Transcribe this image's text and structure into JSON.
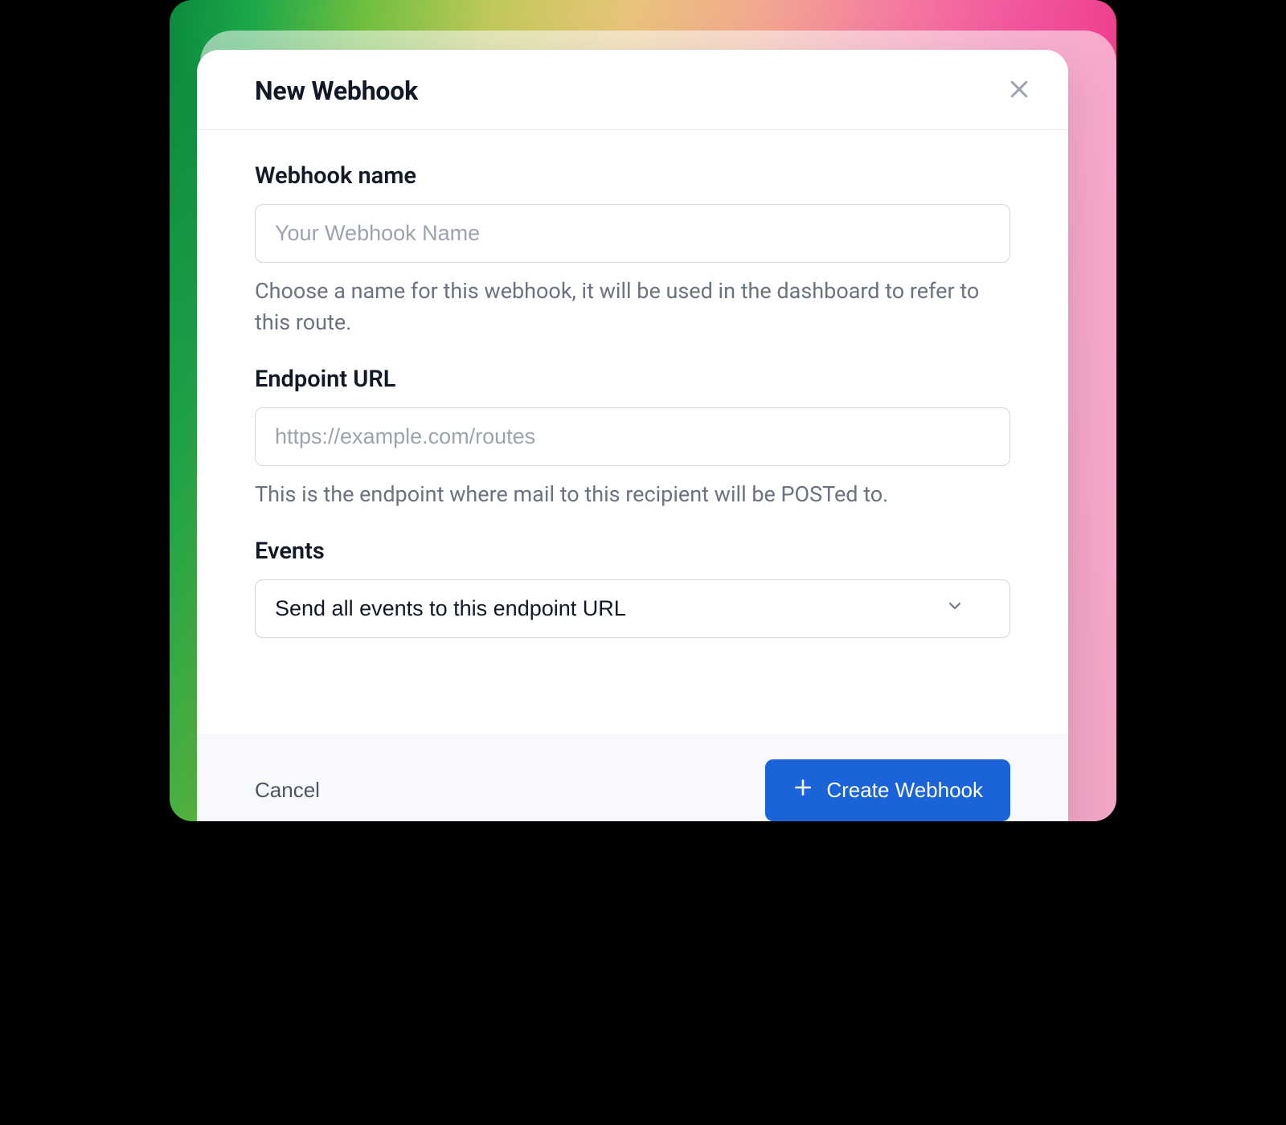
{
  "modal": {
    "title": "New Webhook",
    "fields": {
      "name": {
        "label": "Webhook name",
        "placeholder": "Your Webhook Name",
        "value": "",
        "help": "Choose a name for this webhook, it will be used in the dashboard to refer to this route."
      },
      "endpoint": {
        "label": "Endpoint URL",
        "placeholder": "https://example.com/routes",
        "value": "",
        "help": "This is the endpoint where mail to this recipient will be POSTed to."
      },
      "events": {
        "label": "Events",
        "selected": "Send all events to this endpoint URL"
      }
    },
    "actions": {
      "cancel": "Cancel",
      "submit": "Create Webhook"
    }
  },
  "icons": {
    "close": "close-icon",
    "chevron_down": "chevron-down-icon",
    "plus": "plus-icon"
  }
}
